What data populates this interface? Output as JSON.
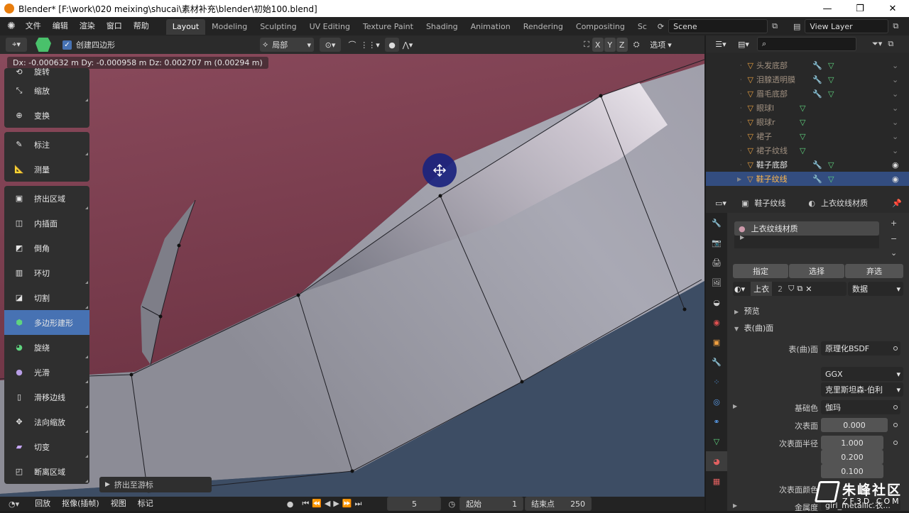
{
  "window": {
    "title": "Blender* [F:\\work\\020 meixing\\shucai\\素材补充\\blender\\初始100.blend]"
  },
  "menu": [
    "文件",
    "编辑",
    "渲染",
    "窗口",
    "帮助"
  ],
  "workspaces": [
    "Layout",
    "Modeling",
    "Sculpting",
    "UV Editing",
    "Texture Paint",
    "Shading",
    "Animation",
    "Rendering",
    "Compositing",
    "Sc"
  ],
  "active_workspace": "Layout",
  "scene": "Scene",
  "view_layer": "View Layer",
  "header": {
    "create_quad": "创建四边形",
    "orientation": "局部",
    "xyz": [
      "X",
      "Y",
      "Z"
    ],
    "options": "选项"
  },
  "status_msg": "Dx: -0.000632 m  Dy: -0.000958 m  Dz: 0.002707 m (0.00294 m)",
  "tools": [
    {
      "group": 1,
      "items": [
        {
          "label": "旋转",
          "icon": "rotate-icon"
        },
        {
          "label": "缩放",
          "icon": "scale-icon"
        },
        {
          "label": "变换",
          "icon": "transform-icon"
        }
      ]
    },
    {
      "group": 2,
      "items": [
        {
          "label": "标注",
          "icon": "annotate-icon"
        },
        {
          "label": "测量",
          "icon": "measure-icon"
        }
      ]
    },
    {
      "group": 3,
      "items": [
        {
          "label": "挤出区域",
          "icon": "extrude-icon"
        },
        {
          "label": "内插面",
          "icon": "inset-icon"
        },
        {
          "label": "倒角",
          "icon": "bevel-icon"
        },
        {
          "label": "环切",
          "icon": "loopcut-icon"
        },
        {
          "label": "切割",
          "icon": "knife-icon"
        },
        {
          "label": "多边形建形",
          "icon": "polybuild-icon",
          "selected": true
        },
        {
          "label": "旋绕",
          "icon": "spin-icon"
        },
        {
          "label": "光滑",
          "icon": "smooth-icon"
        },
        {
          "label": "滑移边线",
          "icon": "edgeslide-icon"
        },
        {
          "label": "法向缩放",
          "icon": "shrink-icon"
        },
        {
          "label": "切变",
          "icon": "shear-icon"
        },
        {
          "label": "断离区域",
          "icon": "rip-icon"
        }
      ]
    }
  ],
  "extrude_panel": "挤出至游标",
  "timeline": {
    "playback": "回放",
    "keying": "抠像(插帧)",
    "view": "视图",
    "marker": "标记",
    "current": "5",
    "start_label": "起始",
    "start": "1",
    "end_label": "结束点",
    "end": "250"
  },
  "outliner": {
    "rows": [
      {
        "name": "头发底部",
        "wrench": true
      },
      {
        "name": "泪腺透明膜",
        "wrench": true
      },
      {
        "name": "眉毛底部",
        "wrench": true
      },
      {
        "name": "眼球l",
        "wrench": false
      },
      {
        "name": "眼球r",
        "wrench": false
      },
      {
        "name": "裙子",
        "wrench": false
      },
      {
        "name": "裙子纹线",
        "wrench": false
      },
      {
        "name": "鞋子底部",
        "wrench": true,
        "bright": true,
        "visible": true
      },
      {
        "name": "鞋子纹线",
        "wrench": true,
        "selected": true,
        "visible": true
      }
    ]
  },
  "properties": {
    "object": "鞋子纹线",
    "material": "上衣纹线材质",
    "slot": "上衣纹线材质",
    "assign": "指定",
    "select": "选择",
    "deselect": "弃选",
    "mat_name": "上衣",
    "users": "2",
    "link": "数据",
    "preview": "预览",
    "surface_section": "表(曲)面",
    "surface_label": "表(曲)面",
    "surface_value": "原理化BSDF",
    "distribution": "GGX",
    "subsurface_method": "克里斯坦森-伯利",
    "base_color_label": "基础色",
    "base_color_value": "伽玛",
    "subsurface_label": "次表面",
    "subsurface_value": "0.000",
    "subsurface_radius_label": "次表面半径",
    "radius": [
      "1.000",
      "0.200",
      "0.100"
    ],
    "subsurface_color_label": "次表面颜色",
    "metallic_label": "金属度",
    "metallic_value": "girl_metallic.衣..."
  },
  "watermark": {
    "cn": "朱峰社区",
    "en": "ZF3D.COM"
  },
  "colors": {
    "accent": "#4772b3",
    "selected_row": "#334d80",
    "orange": "#e87d0d",
    "mesh_fill": "#7d3a4c"
  }
}
